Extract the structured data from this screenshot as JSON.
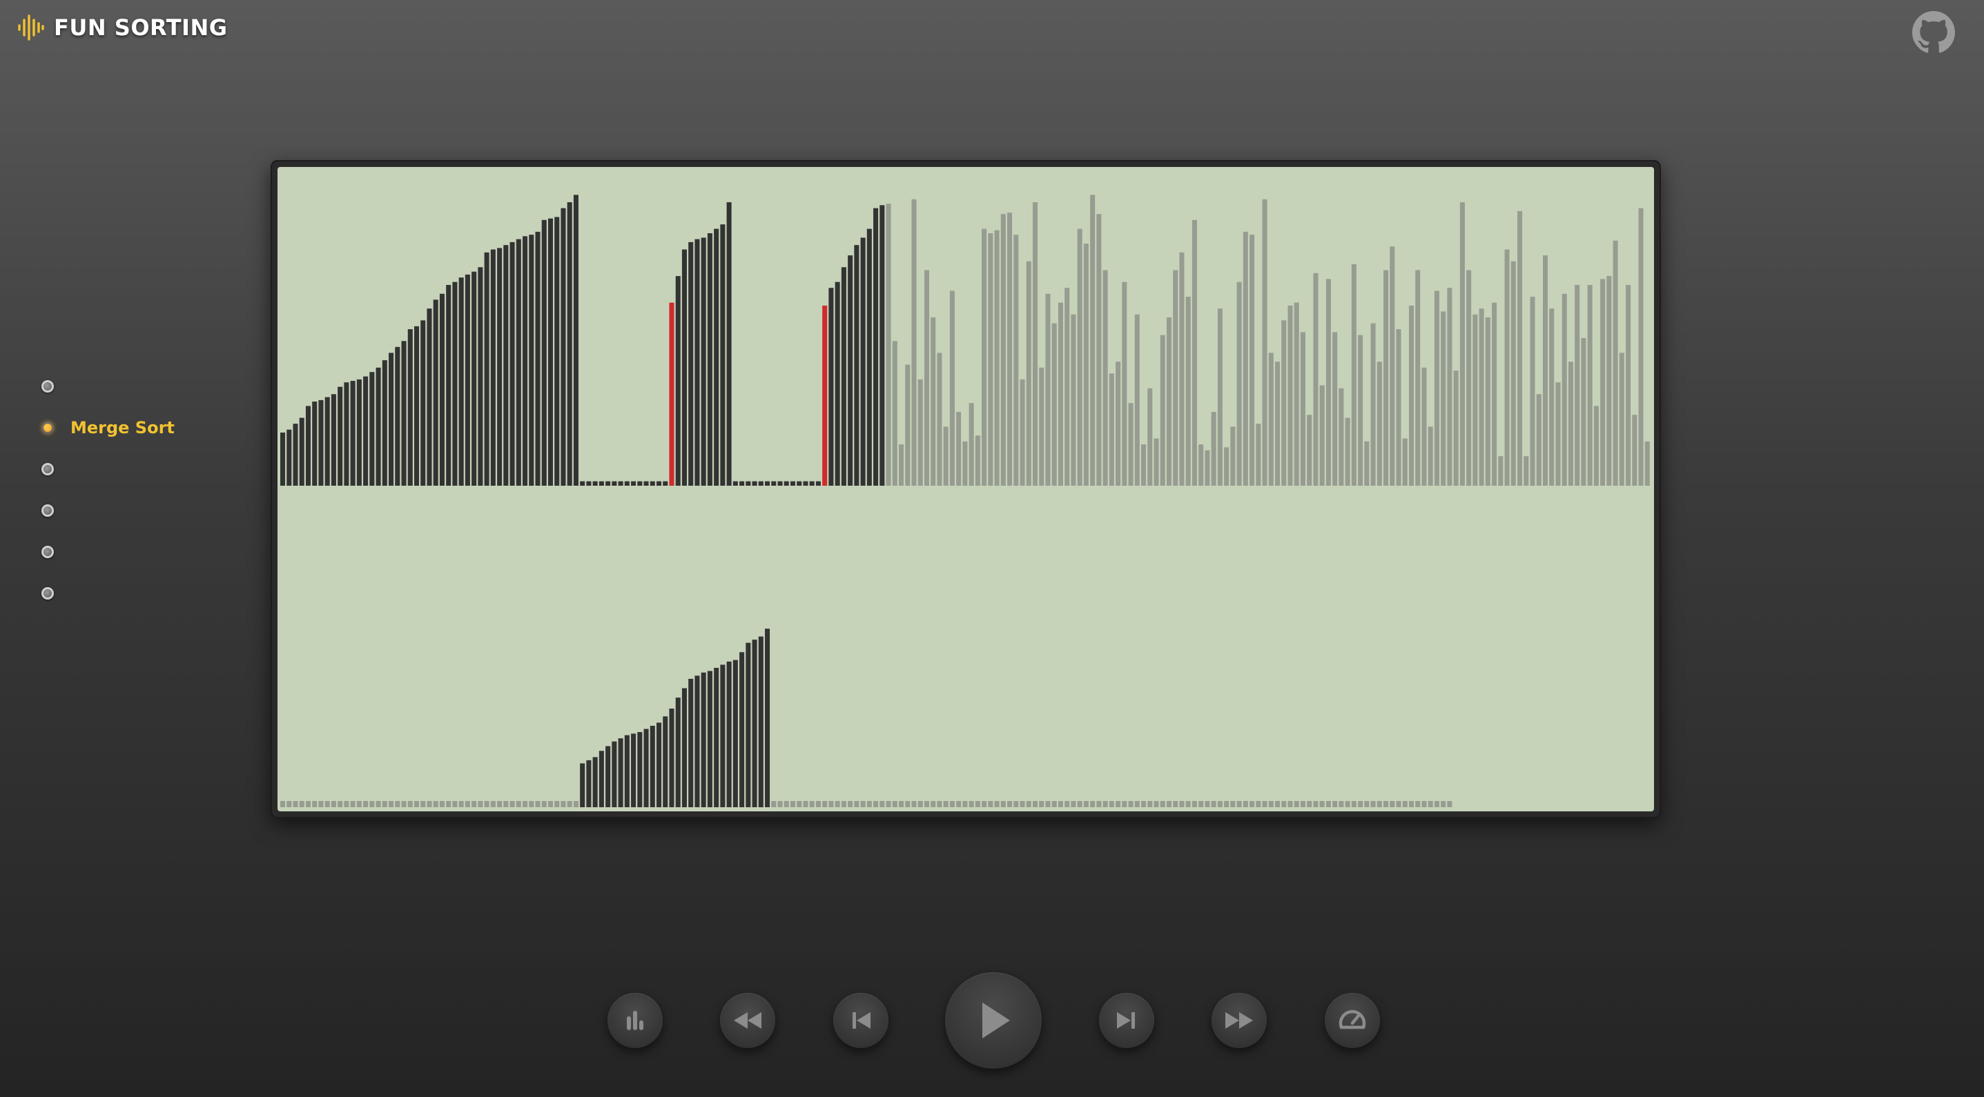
{
  "app": {
    "title": "FUN SORTING",
    "brand_color": "#f2c230"
  },
  "header": {
    "logo_icon": "sound-wave-icon",
    "github_icon": "github-icon"
  },
  "sidebar": {
    "items": [
      {
        "label": "",
        "active": false
      },
      {
        "label": "Merge Sort",
        "active": true
      },
      {
        "label": "",
        "active": false
      },
      {
        "label": "",
        "active": false
      },
      {
        "label": "",
        "active": false
      },
      {
        "label": "",
        "active": false
      }
    ]
  },
  "controls": {
    "buttons": [
      {
        "name": "bar-chart-button",
        "icon": "bar-chart-icon"
      },
      {
        "name": "rewind-button",
        "icon": "rewind-icon"
      },
      {
        "name": "step-back-button",
        "icon": "skip-back-icon"
      },
      {
        "name": "play-button",
        "icon": "play-icon"
      },
      {
        "name": "step-forward-button",
        "icon": "skip-forward-icon"
      },
      {
        "name": "fast-forward-button",
        "icon": "fast-forward-icon"
      },
      {
        "name": "speed-button",
        "icon": "speedometer-icon"
      }
    ]
  },
  "chart_data": {
    "type": "bar",
    "description_colors": {
      "sorted": "#333333",
      "active": "#d12b2b",
      "unsorted": "#979c91",
      "empty": "#333333"
    },
    "main_array": {
      "values": [
        18,
        19,
        21,
        23,
        27,
        28.5,
        29,
        30,
        31,
        33.5,
        35,
        35.5,
        36,
        37,
        38.5,
        40,
        42.5,
        45,
        47,
        49,
        53,
        54,
        56,
        60,
        63,
        65,
        68,
        69,
        70.5,
        71.5,
        72.5,
        74,
        79,
        80,
        80.5,
        81.5,
        82.5,
        83.5,
        84.5,
        85,
        86,
        90,
        90.5,
        91,
        94,
        96,
        98.5,
        1.5,
        1.5,
        1.5,
        1.5,
        1.5,
        1.5,
        1.5,
        1.5,
        1.5,
        1.5,
        1.5,
        1.5,
        1.5,
        1.5,
        62,
        71,
        80,
        82.5,
        83.5,
        84,
        85.5,
        87,
        88.5,
        96,
        1.5,
        1.5,
        1.5,
        1.5,
        1.5,
        1.5,
        1.5,
        1.5,
        1.5,
        1.5,
        1.5,
        1.5,
        1.5,
        1.5,
        61,
        67,
        69,
        74,
        78,
        81.5,
        84,
        87,
        94,
        95,
        95.5,
        49,
        14,
        41,
        97,
        36,
        73,
        57,
        45,
        20,
        66,
        25,
        15,
        28,
        17,
        87,
        85.5,
        86.5,
        92,
        92.5,
        85,
        36,
        76,
        96,
        40,
        65,
        55,
        62,
        67,
        58,
        87,
        82,
        98.5,
        92,
        73,
        38,
        42,
        69,
        28,
        58,
        14,
        33,
        16,
        51,
        57,
        73,
        79,
        64,
        90,
        14,
        12,
        25,
        60,
        13,
        20,
        69,
        86,
        85,
        21,
        97,
        45,
        42,
        56,
        61,
        62,
        52,
        24,
        72,
        34,
        70,
        52,
        33,
        23,
        75,
        51,
        15,
        55,
        42,
        73,
        81,
        53,
        16,
        61,
        73,
        40,
        20,
        66,
        59,
        67,
        39,
        96,
        73,
        58,
        60,
        57,
        62,
        10,
        80,
        76,
        93,
        10,
        64,
        31,
        78,
        60,
        35,
        65,
        42,
        68,
        50,
        68,
        27,
        70,
        71,
        83,
        45,
        68,
        24,
        94,
        15
      ],
      "colors": [
        "sorted",
        "sorted",
        "sorted",
        "sorted",
        "sorted",
        "sorted",
        "sorted",
        "sorted",
        "sorted",
        "sorted",
        "sorted",
        "sorted",
        "sorted",
        "sorted",
        "sorted",
        "sorted",
        "sorted",
        "sorted",
        "sorted",
        "sorted",
        "sorted",
        "sorted",
        "sorted",
        "sorted",
        "sorted",
        "sorted",
        "sorted",
        "sorted",
        "sorted",
        "sorted",
        "sorted",
        "sorted",
        "sorted",
        "sorted",
        "sorted",
        "sorted",
        "sorted",
        "sorted",
        "sorted",
        "sorted",
        "sorted",
        "sorted",
        "sorted",
        "sorted",
        "sorted",
        "sorted",
        "sorted",
        "empty",
        "empty",
        "empty",
        "empty",
        "empty",
        "empty",
        "empty",
        "empty",
        "empty",
        "empty",
        "empty",
        "empty",
        "empty",
        "empty",
        "active",
        "sorted",
        "sorted",
        "sorted",
        "sorted",
        "sorted",
        "sorted",
        "sorted",
        "sorted",
        "sorted",
        "empty",
        "empty",
        "empty",
        "empty",
        "empty",
        "empty",
        "empty",
        "empty",
        "empty",
        "empty",
        "empty",
        "empty",
        "empty",
        "empty",
        "active",
        "sorted",
        "sorted",
        "sorted",
        "sorted",
        "sorted",
        "sorted",
        "sorted",
        "sorted",
        "sorted"
      ],
      "ylim": [
        0,
        100
      ]
    },
    "aux_array": {
      "values": [
        0,
        0,
        0,
        0,
        0,
        0,
        0,
        0,
        0,
        0,
        0,
        0,
        0,
        0,
        0,
        0,
        0,
        0,
        0,
        0,
        0,
        0,
        0,
        0,
        0,
        0,
        0,
        0,
        0,
        0,
        0,
        0,
        0,
        0,
        0,
        0,
        0,
        0,
        0,
        0,
        0,
        0,
        0,
        0,
        0,
        0,
        0,
        14,
        15,
        16,
        18,
        19.5,
        21,
        22,
        23,
        23.5,
        24,
        25,
        26,
        27,
        29,
        31.5,
        35,
        38,
        41,
        42,
        43,
        43.5,
        44.5,
        45.5,
        46.5,
        47,
        49.5,
        52.5,
        53.5,
        54.5,
        57
      ],
      "length": 184,
      "ylim": [
        0,
        100
      ]
    }
  }
}
